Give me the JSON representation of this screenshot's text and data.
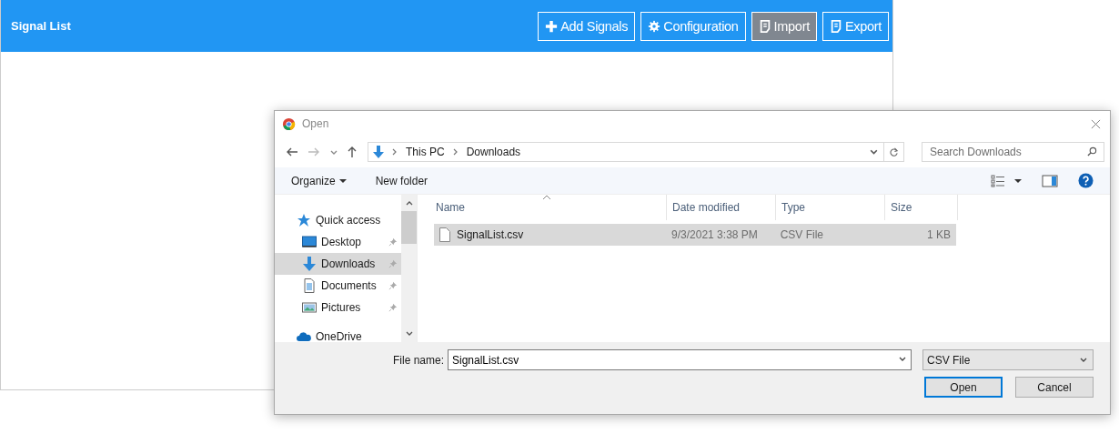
{
  "app": {
    "title": "Signal List",
    "buttons": [
      {
        "label": "Add Signals",
        "kind": "add",
        "selected": false
      },
      {
        "label": "Configuration",
        "kind": "config",
        "selected": false
      },
      {
        "label": "Import",
        "kind": "import",
        "selected": true
      },
      {
        "label": "Export",
        "kind": "export",
        "selected": false
      }
    ]
  },
  "dialog": {
    "title": "Open",
    "breadcrumb": [
      "This PC",
      "Downloads"
    ],
    "search": {
      "placeholder": "Search Downloads"
    },
    "organize": "Organize",
    "new_folder": "New folder",
    "nav": [
      {
        "label": "Quick access",
        "kind": "star",
        "pinned": false,
        "selected": false,
        "children": [
          {
            "label": "Desktop",
            "kind": "desktop",
            "pinned": true,
            "selected": false
          },
          {
            "label": "Downloads",
            "kind": "download",
            "pinned": true,
            "selected": true
          },
          {
            "label": "Documents",
            "kind": "document",
            "pinned": true,
            "selected": false
          },
          {
            "label": "Pictures",
            "kind": "picture",
            "pinned": true,
            "selected": false
          }
        ]
      },
      {
        "label": "OneDrive",
        "kind": "cloud",
        "pinned": false,
        "selected": false
      }
    ],
    "columns": [
      "Name",
      "Date modified",
      "Type",
      "Size"
    ],
    "rows": [
      {
        "cells": [
          "SignalList.csv",
          "9/3/2021 3:38 PM",
          "CSV File",
          "1 KB"
        ],
        "selected": true
      }
    ],
    "file_name": {
      "label": "File name:",
      "value": "SignalList.csv"
    },
    "file_type": "CSV File",
    "buttons": [
      {
        "label": "Open",
        "default": true
      },
      {
        "label": "Cancel",
        "default": false
      }
    ]
  }
}
